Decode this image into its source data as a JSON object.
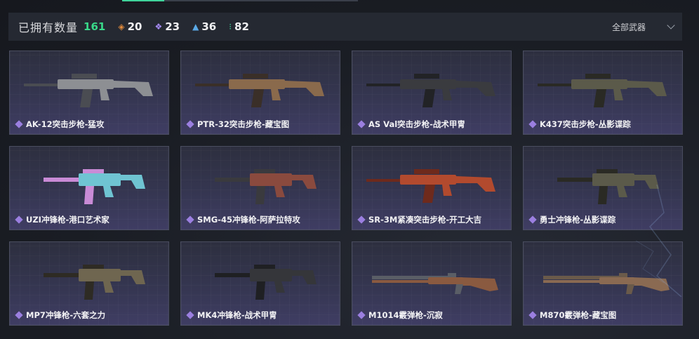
{
  "header": {
    "owned_label": "已拥有数量",
    "owned_count": "161",
    "stats": [
      {
        "icon": "orange-rarity-icon",
        "glyph": "◈",
        "color": "#e08a3c",
        "value": "20"
      },
      {
        "icon": "purple-rarity-icon",
        "glyph": "❖",
        "color": "#a78bfa",
        "value": "23"
      },
      {
        "icon": "blue-rarity-icon",
        "glyph": "▲",
        "color": "#5aa9e6",
        "value": "36"
      },
      {
        "icon": "green-rarity-icon",
        "glyph": "⁝",
        "color": "#3fd39a",
        "value": "82"
      }
    ],
    "filter_label": "全部武器"
  },
  "weapons": [
    {
      "name": "AK-12突击步枪-猛攻",
      "body": "#8d8f93",
      "accent": "#4a4c52"
    },
    {
      "name": "PTR-32突击步枪-藏宝图",
      "body": "#8a6a4c",
      "accent": "#3a2f28"
    },
    {
      "name": "AS Val突击步枪-战术甲冑",
      "body": "#3a3b3f",
      "accent": "#222326"
    },
    {
      "name": "K437突击步枪-丛影谍踪",
      "body": "#5b5a4a",
      "accent": "#2a2a24"
    },
    {
      "name": "UZI冲锋枪-港口艺术家",
      "body": "#6fc4d2",
      "accent": "#c98bd6"
    },
    {
      "name": "SMG-45冲锋枪-阿萨拉特攻",
      "body": "#8a4a3e",
      "accent": "#3a3a3e"
    },
    {
      "name": "SR-3M紧凑突击步枪-开工大吉",
      "body": "#b24a2e",
      "accent": "#6e2a1c"
    },
    {
      "name": "勇士冲锋枪-丛影谍踪",
      "body": "#5b5a4a",
      "accent": "#2a2a24"
    },
    {
      "name": "MP7冲锋枪-六套之力",
      "body": "#6f6650",
      "accent": "#2e2b24"
    },
    {
      "name": "MK4冲锋枪-战术甲冑",
      "body": "#35363a",
      "accent": "#1f2023"
    },
    {
      "name": "M1014霰弹枪-沉寂",
      "body": "#8a5a40",
      "accent": "#5a5e66"
    },
    {
      "name": "M870霰弹枪-藏宝图",
      "body": "#8a6a52",
      "accent": "#6a5a4a"
    }
  ]
}
